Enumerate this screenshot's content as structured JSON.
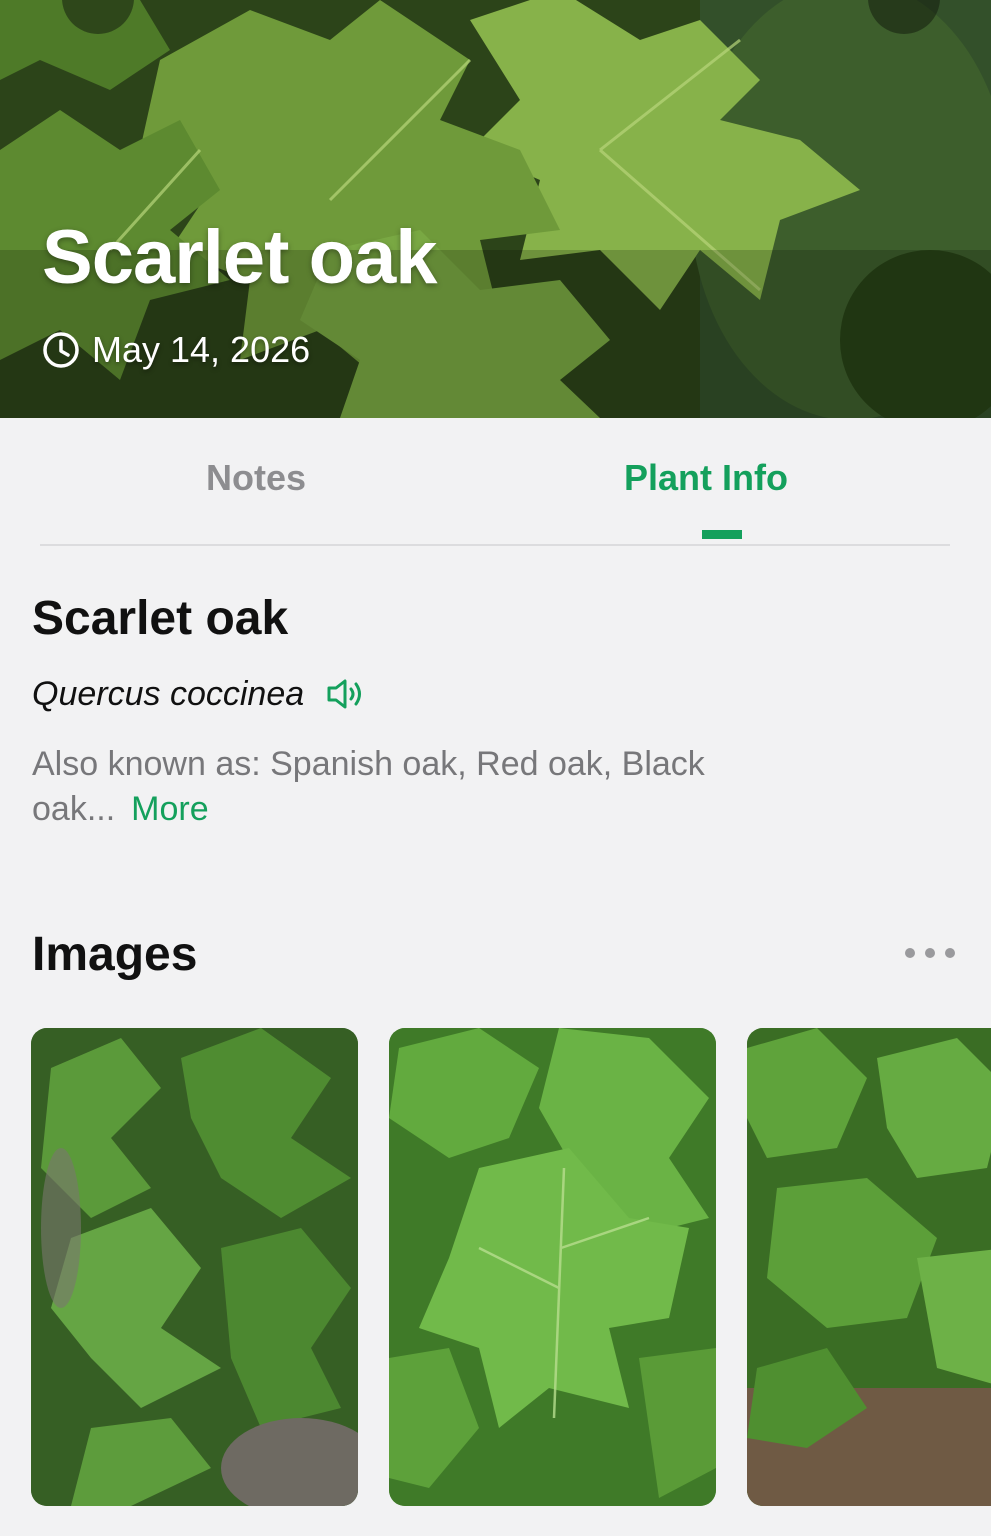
{
  "hero": {
    "title": "Scarlet oak",
    "date": "May 14, 2026"
  },
  "tabs": [
    {
      "label": "Notes",
      "active": false
    },
    {
      "label": "Plant Info",
      "active": true
    }
  ],
  "plant": {
    "common_name": "Scarlet oak",
    "scientific_name": "Quercus coccinea",
    "aka_text": "Also known as: Spanish oak, Red oak, Black oak...",
    "more_label": "More"
  },
  "images": {
    "title": "Images"
  },
  "colors": {
    "accent": "#14a05c",
    "background": "#f2f2f3",
    "muted_text": "#77777a"
  },
  "icons": {
    "date": "clock-icon",
    "pronounce": "speaker-icon",
    "images_menu": "more-horizontal-icon"
  }
}
